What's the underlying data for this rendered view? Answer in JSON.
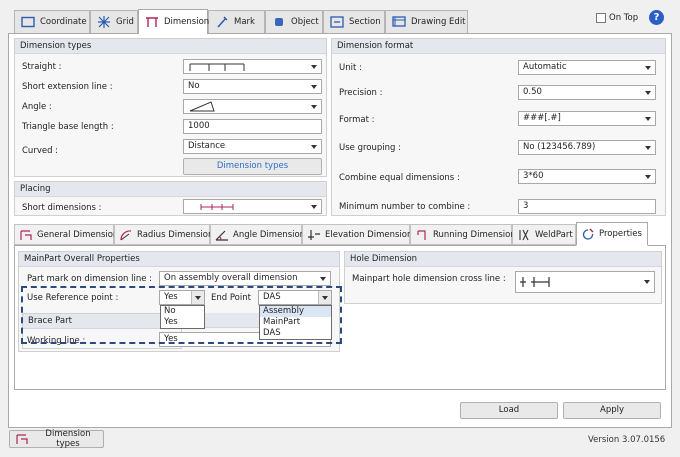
{
  "top_tabs": [
    {
      "label": "Coordinate",
      "icon": "coordinate-icon"
    },
    {
      "label": "Grid",
      "icon": "grid-icon"
    },
    {
      "label": "Dimension",
      "icon": "dimension-icon"
    },
    {
      "label": "Mark",
      "icon": "mark-icon"
    },
    {
      "label": "Object",
      "icon": "object-icon"
    },
    {
      "label": "Section",
      "icon": "section-icon"
    },
    {
      "label": "Drawing Edit",
      "icon": "drawing-edit-icon"
    }
  ],
  "on_top": {
    "label": "On Top",
    "checked": false
  },
  "dimension_types": {
    "title": "Dimension types",
    "straight_label": "Straight :",
    "short_ext_label": "Short extension line :",
    "short_ext_value": "No",
    "angle_label": "Angle  :",
    "tri_base_label": "Triangle base length :",
    "tri_base_value": "1000",
    "curved_label": "Curved :",
    "curved_value": "Distance",
    "types_button": "Dimension types"
  },
  "placing": {
    "title": "Placing",
    "short_dims_label": "Short dimensions :"
  },
  "dimension_format": {
    "title": "Dimension format",
    "unit_label": "Unit :",
    "unit_value": "Automatic",
    "precision_label": "Precision :",
    "precision_value": "0.50",
    "format_label": "Format :",
    "format_value": "###[.#]",
    "grouping_label": "Use grouping :",
    "grouping_value": "No (123456.789)",
    "combine_label": "Combine equal dimensions :",
    "combine_value": "3*60",
    "min_combine_label": "Minimum number to combine :",
    "min_combine_value": "3"
  },
  "sub_tabs": [
    {
      "label": "General Dimension",
      "icon": "general-dimension-icon"
    },
    {
      "label": "Radius Dimension",
      "icon": "radius-dimension-icon"
    },
    {
      "label": "Angle Dimension",
      "icon": "angle-dimension-icon"
    },
    {
      "label": "Elevation Dimension",
      "icon": "elevation-dimension-icon"
    },
    {
      "label": "Running Dimension",
      "icon": "running-dimension-icon"
    },
    {
      "label": "WeldPart",
      "icon": "weldpart-icon"
    },
    {
      "label": "Properties",
      "icon": "properties-icon"
    }
  ],
  "mainpart": {
    "title": "MainPart Overall Properties",
    "part_mark_label": "Part mark on dimension line :",
    "part_mark_value": "On assembly overall dimension",
    "use_ref_label": "Use Reference point :",
    "use_ref_value": "Yes",
    "use_ref_options": [
      "No",
      "Yes"
    ],
    "end_point_label": "End Point",
    "end_point_value": "DAS",
    "end_point_options": [
      "Assembly",
      "MainPart",
      "DAS"
    ]
  },
  "brace": {
    "title": "Brace Part",
    "working_line_label": "Working line :",
    "working_line_value": "Yes"
  },
  "hole": {
    "title": "Hole Dimension",
    "cross_line_label": "Mainpart hole dimension cross line :"
  },
  "buttons": {
    "load": "Load",
    "apply": "Apply"
  },
  "status": {
    "button": "Dimension types",
    "version": "Version 3.07.0156"
  },
  "colors": {
    "accent": "#2c6ec9",
    "dashed_highlight": "#2b4a7e",
    "tab_active_icon": "#b0255a"
  }
}
